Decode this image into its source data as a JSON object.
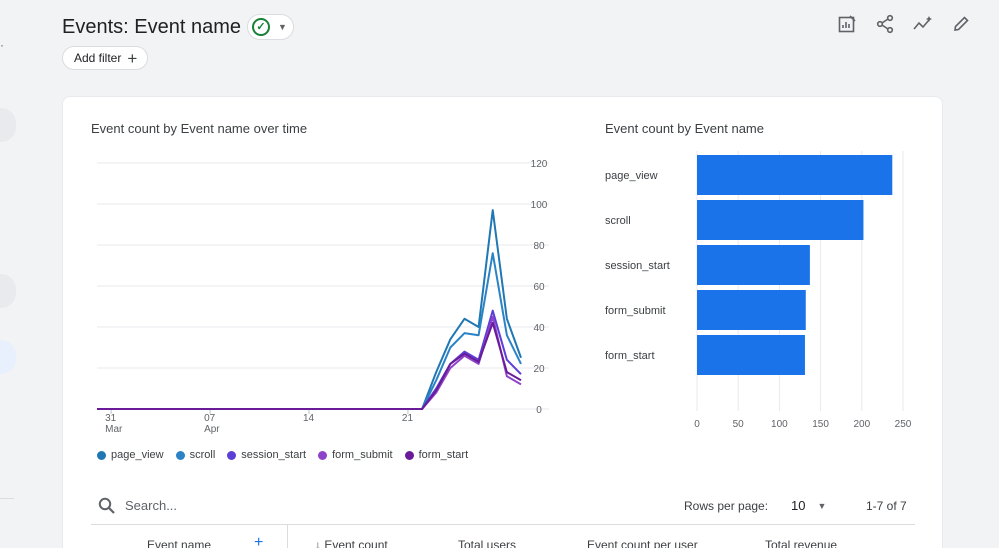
{
  "header": {
    "title": "Events: Event name",
    "add_filter_label": "Add filter",
    "status": "check-circle-icon",
    "tools": [
      "edit-report-icon",
      "share-icon",
      "insights-icon",
      "pencil-icon"
    ]
  },
  "colors": {
    "accent": "#1a73e8",
    "series": [
      "#1f77b4",
      "#2b83c6",
      "#5b3fd6",
      "#8e44c8",
      "#6a1b9a"
    ],
    "bar": "#1a73e8",
    "status_green": "#188038"
  },
  "line_chart": {
    "title": "Event count by Event name over time"
  },
  "bar_chart": {
    "title": "Event count by Event name"
  },
  "legend": [
    "page_view",
    "scroll",
    "session_start",
    "form_submit",
    "form_start"
  ],
  "chart_data": [
    {
      "type": "line",
      "title": "Event count by Event name over time",
      "x_ticks": [
        {
          "day": "31",
          "month": "Mar"
        },
        {
          "day": "07",
          "month": "Apr"
        },
        {
          "day": "14",
          "month": ""
        },
        {
          "day": "21",
          "month": ""
        }
      ],
      "ylim": [
        0,
        120
      ],
      "y_ticks": [
        0,
        20,
        40,
        60,
        80,
        100,
        120
      ],
      "x_points": 31,
      "series": [
        {
          "name": "page_view",
          "values": [
            0,
            0,
            0,
            0,
            0,
            0,
            0,
            0,
            0,
            0,
            0,
            0,
            0,
            0,
            0,
            0,
            0,
            0,
            0,
            0,
            0,
            0,
            0,
            0,
            18,
            34,
            44,
            40,
            97,
            44,
            25
          ]
        },
        {
          "name": "scroll",
          "values": [
            0,
            0,
            0,
            0,
            0,
            0,
            0,
            0,
            0,
            0,
            0,
            0,
            0,
            0,
            0,
            0,
            0,
            0,
            0,
            0,
            0,
            0,
            0,
            0,
            14,
            30,
            37,
            36,
            76,
            36,
            22
          ]
        },
        {
          "name": "session_start",
          "values": [
            0,
            0,
            0,
            0,
            0,
            0,
            0,
            0,
            0,
            0,
            0,
            0,
            0,
            0,
            0,
            0,
            0,
            0,
            0,
            0,
            0,
            0,
            0,
            0,
            10,
            22,
            28,
            24,
            48,
            24,
            17
          ]
        },
        {
          "name": "form_submit",
          "values": [
            0,
            0,
            0,
            0,
            0,
            0,
            0,
            0,
            0,
            0,
            0,
            0,
            0,
            0,
            0,
            0,
            0,
            0,
            0,
            0,
            0,
            0,
            0,
            0,
            8,
            20,
            26,
            22,
            45,
            16,
            12
          ]
        },
        {
          "name": "form_start",
          "values": [
            0,
            0,
            0,
            0,
            0,
            0,
            0,
            0,
            0,
            0,
            0,
            0,
            0,
            0,
            0,
            0,
            0,
            0,
            0,
            0,
            0,
            0,
            0,
            0,
            9,
            22,
            27,
            23,
            42,
            18,
            14
          ]
        }
      ],
      "grid": true
    },
    {
      "type": "bar",
      "orientation": "horizontal",
      "title": "Event count by Event name",
      "categories": [
        "page_view",
        "scroll",
        "session_start",
        "form_submit",
        "form_start"
      ],
      "values": [
        237,
        202,
        137,
        132,
        131
      ],
      "xlim": [
        0,
        250
      ],
      "x_ticks": [
        0,
        50,
        100,
        150,
        200,
        250
      ],
      "grid": true
    }
  ],
  "table": {
    "search_placeholder": "Search...",
    "rows_per_page_label": "Rows per page:",
    "rows_per_page_value": "10",
    "page_range": "1-7 of 7",
    "columns": [
      "Event name",
      "↓ Event count",
      "Total users",
      "Event count per user",
      "Total revenue"
    ]
  }
}
